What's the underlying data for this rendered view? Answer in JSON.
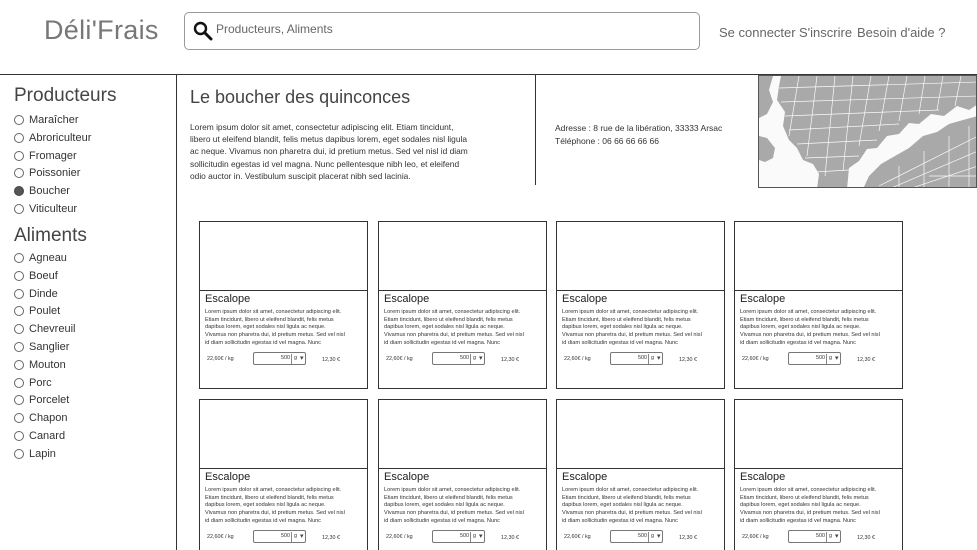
{
  "header": {
    "logo": "Déli'Frais",
    "search_placeholder": "Producteurs, Aliments",
    "links": [
      "Se connecter",
      "S'inscrire",
      "Besoin d'aide ?"
    ]
  },
  "sidebar": {
    "producteurs_title": "Producteurs",
    "producteurs": [
      {
        "label": "Maraîcher",
        "checked": false
      },
      {
        "label": "Abroriculteur",
        "checked": false
      },
      {
        "label": "Fromager",
        "checked": false
      },
      {
        "label": "Poissonier",
        "checked": false
      },
      {
        "label": "Boucher",
        "checked": true
      },
      {
        "label": "Viticulteur",
        "checked": false
      }
    ],
    "aliments_title": "Aliments",
    "aliments": [
      "Agneau",
      "Boeuf",
      "Dinde",
      "Poulet",
      "Chevreuil",
      "Sanglier",
      "Mouton",
      "Porc",
      "Porcelet",
      "Chapon",
      "Canard",
      "Lapin"
    ]
  },
  "producer": {
    "title": "Le boucher des quinconces",
    "description_lines": [
      "Lorem ipsum dolor sit amet, consectetur adipiscing elit. Etiam tincidunt,",
      "libero ut eleifend blandit, felis metus dapibus lorem, eget sodales nisl ligula",
      "ac neque. Vivamus non pharetra dui, id pretium metus. Sed vel nisl id diam",
      "sollicitudin egestas id vel magna. Nunc pellentesque nibh leo, et eleifend",
      "odio auctor in. Vestibulum suscipit placerat nibh sed lacinia."
    ],
    "address": "Adresse : 8 rue de la libération, 33333 Arsac",
    "phone": "Téléphone : 06 66 66 66 66"
  },
  "product_card": {
    "title": "Escalope",
    "description_lines": [
      "Lorem ipsum dolor sit amet, consectetur adipiscing elit.",
      "Etiam tincidunt, libero ut eleifend blandit, felis metus",
      "dapibus lorem, eget sodales nisl ligula ac neque.",
      "Vivamus non pharetra dui, id pretium metus. Sed vel nisl",
      "id diam sollicitudin egestas id vel magna. Nunc"
    ],
    "unit_price": "22,60€ / kg",
    "quantity": "500",
    "unit": "g",
    "total": "12,30 €"
  },
  "product_count": 8,
  "colors": {
    "border": "#333333",
    "map_land": "#a9a9a9",
    "map_water": "#fafafa"
  }
}
